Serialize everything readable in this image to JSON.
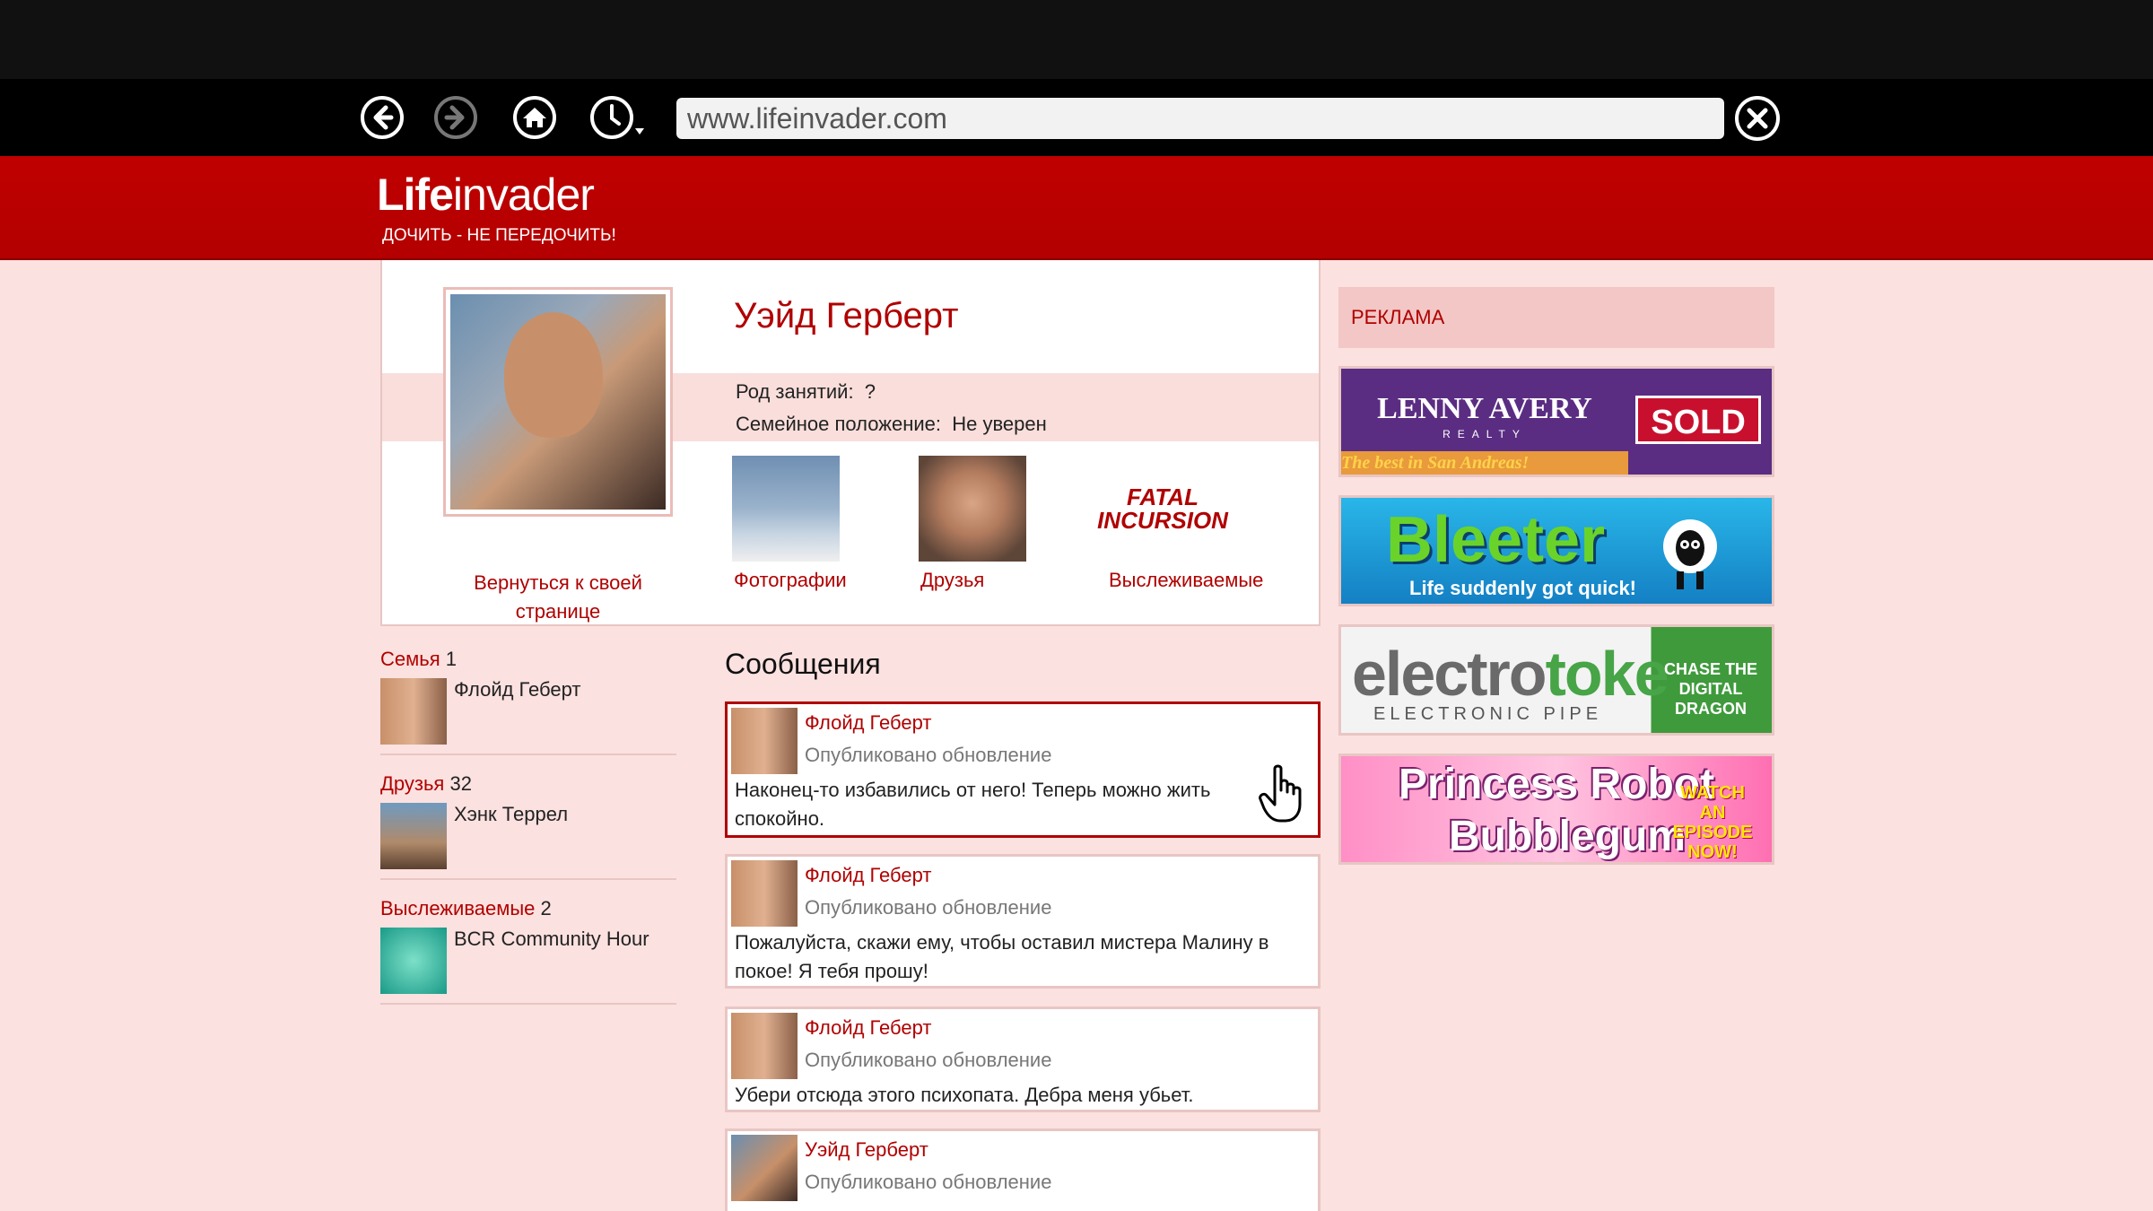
{
  "browser": {
    "url": "www.lifeinvader.com"
  },
  "site": {
    "logo_bold": "Life",
    "logo_rest": "invader",
    "tagline": "ДОЧИТЬ - НЕ ПЕРЕДОЧИТЬ!"
  },
  "profile": {
    "name": "Уэйд Герберт",
    "occupation_label": "Род занятий:",
    "occupation_value": "?",
    "relationship_label": "Семейное положение:",
    "relationship_value": "Не уверен",
    "back_link": "Вернуться к своей странице",
    "tabs": [
      {
        "label": "Фотографии"
      },
      {
        "label": "Друзья"
      },
      {
        "label": "Выслеживаемые"
      }
    ],
    "tracked_thumb_text": "FATAL INCURSION"
  },
  "sidebar": {
    "family": {
      "title": "Семья",
      "count": "1",
      "name": "Флойд Геберт"
    },
    "friends": {
      "title": "Друзья",
      "count": "32",
      "name": "Хэнк Террел"
    },
    "tracked": {
      "title": "Выслеживаемые",
      "count": "2",
      "name": "BCR Community Hour"
    }
  },
  "messages": {
    "heading": "Сообщения",
    "items": [
      {
        "author": "Флойд Геберт",
        "sub": "Опубликовано обновление",
        "text": "Наконец-то избавились от него! Теперь можно жить спокойно."
      },
      {
        "author": "Флойд Геберт",
        "sub": "Опубликовано обновление",
        "text": "Пожалуйста, скажи ему, чтобы оставил мистера Малину в покое! Я тебя прошу!"
      },
      {
        "author": "Флойд Геберт",
        "sub": "Опубликовано обновление",
        "text": "Убери отсюда этого психопата. Дебра меня убьет."
      },
      {
        "author": "Уэйд Герберт",
        "sub": "Опубликовано обновление",
        "text": ""
      }
    ]
  },
  "ads": {
    "title": "РЕКЛАМА",
    "lenny": {
      "name": "LENNY AVERY",
      "realty": "REALTY",
      "slogan": "The best in San Andreas!",
      "sold": "SOLD"
    },
    "bleeter": {
      "word": "Bleeter",
      "sub": "Life suddenly got quick!"
    },
    "electrotoke": {
      "word_a": "electro",
      "word_b": "toke",
      "sub": "ELECTRONIC PIPE",
      "right": "CHASE THE DIGITAL DRAGON"
    },
    "princess": {
      "line1": "Princess Robot",
      "line2": "Bubblegum",
      "watch": "WATCH AN EPISODE NOW!"
    }
  }
}
